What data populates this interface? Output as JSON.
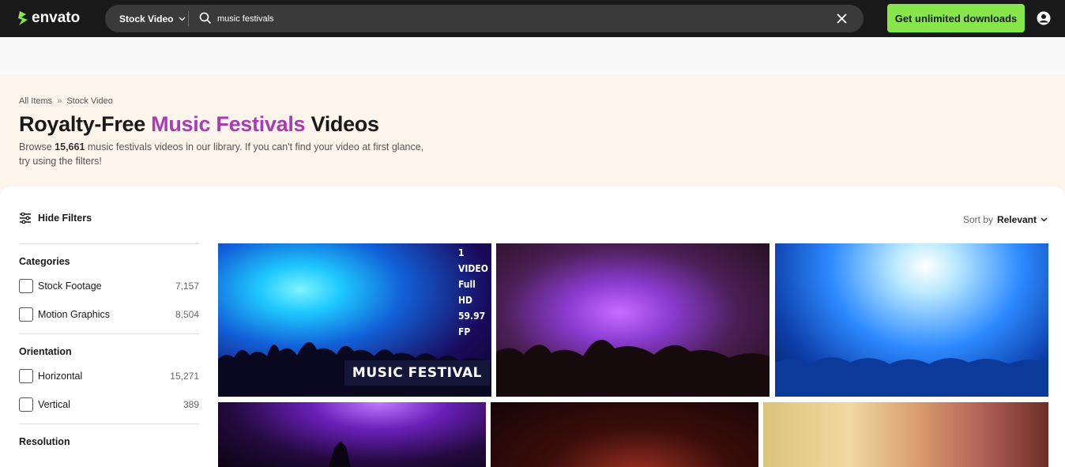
{
  "header": {
    "logo_text": "envato",
    "category": "Stock Video",
    "search_value": "music festivals",
    "cta_label": "Get unlimited downloads"
  },
  "hero": {
    "breadcrumb": [
      "All Items",
      "»",
      "Stock Video"
    ],
    "title_prefix": "Royalty-Free",
    "title_accent": "Music Festivals",
    "title_suffix": "Videos",
    "desc_before": "Browse",
    "desc_count": "15,661",
    "desc_after": "music festivals videos in our library. If you can't find your video at first glance, try using the filters!"
  },
  "toolbar": {
    "hide_filters_label": "Hide Filters",
    "sort_prefix": "Sort by",
    "sort_value": "Relevant"
  },
  "filters": {
    "categories": {
      "title": "Categories",
      "options": [
        {
          "label": "Stock Footage",
          "count": "7,157"
        },
        {
          "label": "Motion Graphics",
          "count": "8,504"
        }
      ]
    },
    "orientation": {
      "title": "Orientation",
      "options": [
        {
          "label": "Horizontal",
          "count": "15,271"
        },
        {
          "label": "Vertical",
          "count": "389"
        }
      ]
    },
    "resolution": {
      "title": "Resolution"
    }
  },
  "results": {
    "first_thumb_tag_lines": [
      "1 VIDEO",
      "Full HD",
      "59.97 FP"
    ],
    "first_thumb_title": "MUSIC FESTIVAL"
  },
  "colors": {
    "topbar": "#191919",
    "cta": "#87e64b",
    "accent": "#a83cb6",
    "hero_bg": "#fdf4ec"
  }
}
